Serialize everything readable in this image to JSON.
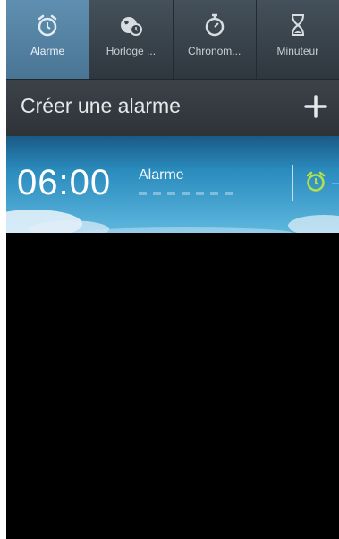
{
  "tabs": [
    {
      "label": "Alarme",
      "icon": "alarm-clock-icon",
      "active": true
    },
    {
      "label": "Horloge ...",
      "icon": "world-clock-icon",
      "active": false
    },
    {
      "label": "Chronom...",
      "icon": "stopwatch-icon",
      "active": false
    },
    {
      "label": "Minuteur",
      "icon": "hourglass-icon",
      "active": false
    }
  ],
  "create": {
    "label": "Créer une alarme",
    "add_icon": "plus-icon"
  },
  "alarm": {
    "time": "06:00",
    "name": "Alarme",
    "toggle_icon": "alarm-clock-icon",
    "toggle_color": "#b4e04a"
  },
  "colors": {
    "tab_active": "#5f8fb0",
    "card_top": "#1a5a86",
    "card_bottom": "#5eb7de"
  }
}
